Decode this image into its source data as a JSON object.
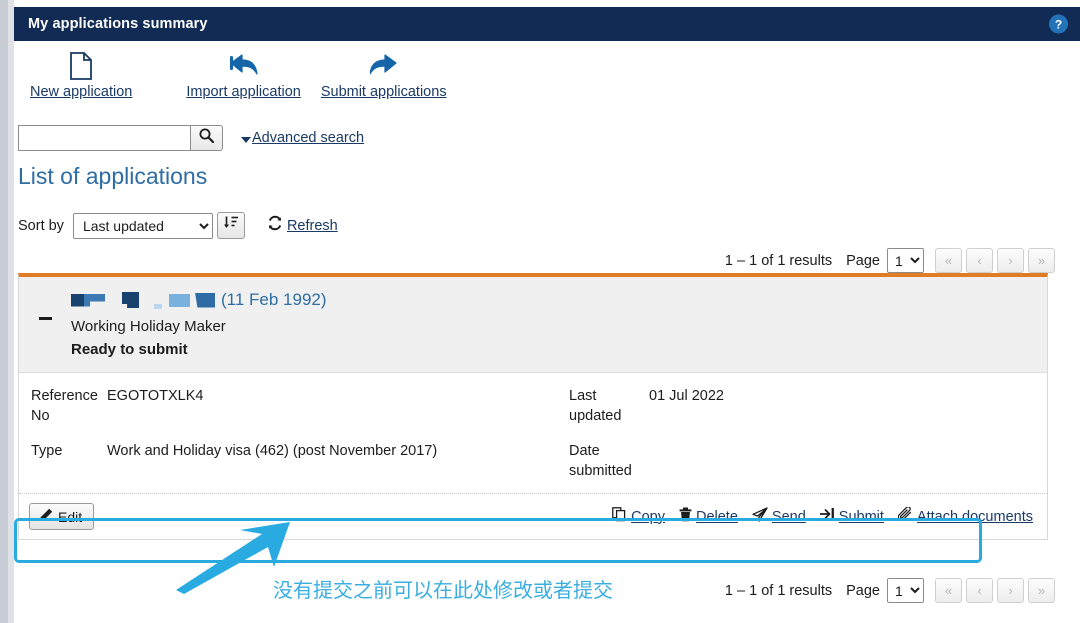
{
  "window": {
    "title": "My applications summary",
    "help_icon": "help-circle-icon",
    "help_label": "?"
  },
  "toolbar": {
    "items": [
      {
        "label": "New application",
        "icon": "new-document-icon"
      },
      {
        "label": "Import application",
        "icon": "reply-arrow-icon"
      },
      {
        "label": "Submit applications",
        "icon": "forward-arrow-icon"
      }
    ]
  },
  "search": {
    "value": "",
    "placeholder": "",
    "button_icon": "search-icon",
    "advanced_label": "Advanced search"
  },
  "list": {
    "heading": "List of applications",
    "sort_label": "Sort by",
    "sort_value": "Last updated",
    "sort_options": [
      "Last updated"
    ],
    "sort_direction_icon": "sort-descending-icon",
    "refresh_label": "Refresh",
    "refresh_icon": "refresh-icon"
  },
  "pagination": {
    "results_text": "1 – 1 of 1 results",
    "page_label": "Page",
    "page_value": "1",
    "page_options": [
      "1"
    ],
    "first_label": "«",
    "prev_label": "‹",
    "next_label": "›",
    "last_label": "»"
  },
  "application": {
    "collapse_icon": "collapse-minus-icon",
    "applicant_name_redacted": true,
    "date_of_birth": "(11 Feb 1992)",
    "stream": "Working Holiday Maker",
    "status": "Ready to submit",
    "details_left": [
      {
        "label": "Reference No",
        "value": "EGOTOTXLK4"
      },
      {
        "label": "Type",
        "value": "Work and Holiday visa (462) (post November 2017)"
      }
    ],
    "details_right": [
      {
        "label": "Last updated",
        "value": "01 Jul 2022"
      },
      {
        "label": "Date submitted",
        "value": ""
      }
    ],
    "edit_label": "Edit",
    "edit_icon": "pencil-icon",
    "actions": [
      {
        "label": "Copy",
        "icon": "copy-icon"
      },
      {
        "label": "Delete",
        "icon": "trash-icon"
      },
      {
        "label": "Send",
        "icon": "paper-plane-icon"
      },
      {
        "label": "Submit",
        "icon": "sign-in-arrow-icon"
      },
      {
        "label": "Attach documents",
        "icon": "paperclip-icon"
      }
    ]
  },
  "annotation": {
    "text": "没有提交之前可以在此处修改或者提交",
    "color": "#3aaee0",
    "arrow_icon": "annotation-arrow-icon"
  },
  "colors": {
    "header_bg": "#112b54",
    "accent_orange": "#e07b26",
    "link_blue": "#1a3a66",
    "heading_blue": "#2e6da4",
    "highlight_cyan": "#29abe2"
  }
}
